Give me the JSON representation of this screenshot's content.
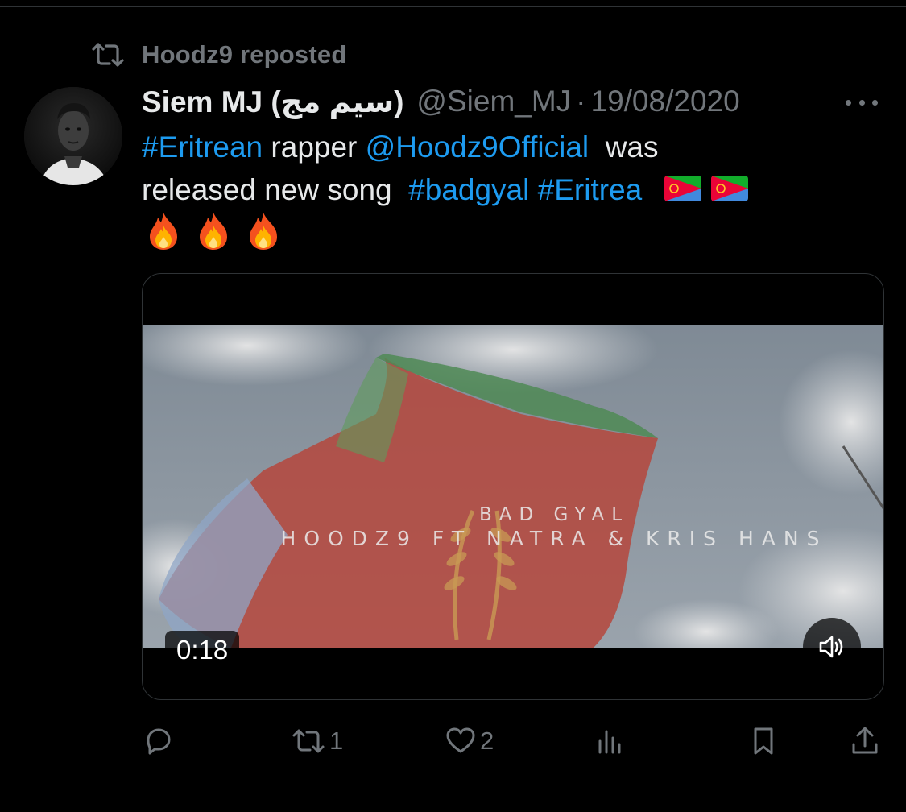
{
  "repost": {
    "label": "Hoodz9 reposted",
    "icon": "repost-icon"
  },
  "tweet": {
    "display_name": "Siem MJ (سيم مج)",
    "handle": "@Siem_MJ",
    "separator": "·",
    "date": "19/08/2020",
    "text": {
      "line1": {
        "hashtag1": "#Eritrean",
        "plain1": " rapper ",
        "mention": "@Hoodz9Official",
        "plain2": "  was"
      },
      "line2": {
        "plain": "released new song  ",
        "hashtag2": "#badgyal",
        "space": " ",
        "hashtag3": "#Eritrea"
      },
      "emojis": {
        "flags": [
          "flag-eritrea-icon",
          "flag-eritrea-icon"
        ],
        "fire": [
          "fire-icon",
          "fire-icon",
          "fire-icon"
        ]
      }
    }
  },
  "media": {
    "video_title_line1": "BAD GYAL",
    "video_title_line2": "HOODZ9 FT NATRA & KRIS HANS",
    "duration": "0:18",
    "volume_icon": "volume-icon"
  },
  "actions": {
    "reply": {
      "icon": "reply-icon",
      "count": ""
    },
    "repost": {
      "icon": "repost-icon",
      "count": "1"
    },
    "like": {
      "icon": "heart-icon",
      "count": "2"
    },
    "views": {
      "icon": "views-icon",
      "count": ""
    },
    "bookmark": {
      "icon": "bookmark-icon"
    },
    "share": {
      "icon": "share-icon"
    }
  },
  "colors": {
    "background": "#000000",
    "text": "#e7e9ea",
    "muted": "#71767b",
    "link": "#1d9bf0",
    "border": "#2f3336"
  }
}
